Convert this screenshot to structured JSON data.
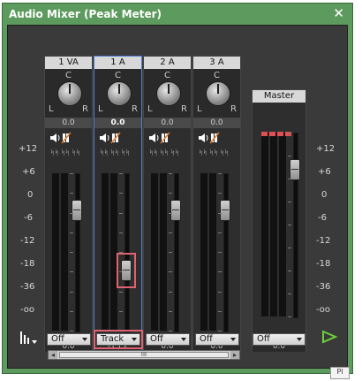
{
  "window": {
    "title": "Audio Mixer (Peak Meter)",
    "close_label": "✕"
  },
  "channels": [
    {
      "name": "1 VA",
      "pan_c": "C",
      "pan_l": "L",
      "pan_r": "R",
      "pan_value": "0.0",
      "fader_value": "0.0",
      "mode": "Off"
    },
    {
      "name": "1 A",
      "pan_c": "C",
      "pan_l": "L",
      "pan_r": "R",
      "pan_value": "0.0",
      "fader_value": "-13.2",
      "mode": "Track"
    },
    {
      "name": "2 A",
      "pan_c": "C",
      "pan_l": "L",
      "pan_r": "R",
      "pan_value": "0.0",
      "fader_value": "0.0",
      "mode": "Off"
    },
    {
      "name": "3 A",
      "pan_c": "C",
      "pan_l": "L",
      "pan_r": "R",
      "pan_value": "0.0",
      "fader_value": "0.0",
      "mode": "Off"
    }
  ],
  "master": {
    "name": "Master",
    "fader_value": "0.0",
    "mode": "Off"
  },
  "scale_left": [
    "+12",
    "+6",
    "0",
    "-6",
    "-12",
    "-18",
    "-36",
    "-oo"
  ],
  "scale_right": [
    "+12",
    "+6",
    "0",
    "-6",
    "-12",
    "-18",
    "-36",
    "-oo"
  ],
  "scrollbar": {
    "thumb_label": "III",
    "left_arrow": "◂",
    "right_arrow": "▸"
  },
  "tooltip_text": "Pl",
  "play_icon": "play-icon",
  "colors": {
    "accent_selected": "#4c7fd6",
    "highlight": "#e0616f",
    "mute_slash": "#e07a2c",
    "play": "#6ecf3a"
  }
}
